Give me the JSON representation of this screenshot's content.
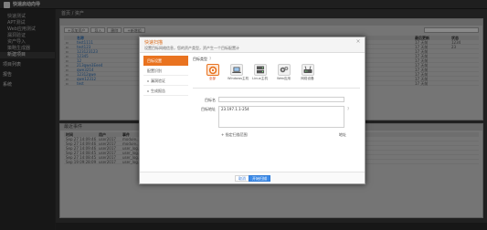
{
  "app": {
    "title": "快速启动向导"
  },
  "breadcrumb": "首页 / 资产",
  "sidebar": {
    "items": [
      {
        "label": "快速测试",
        "active": false
      },
      {
        "label": "APT测试",
        "active": false
      },
      {
        "label": "Web应用测试",
        "active": false
      },
      {
        "label": "漏洞验证",
        "active": false
      },
      {
        "label": "资产导入",
        "active": false
      },
      {
        "label": "策略生成器",
        "active": false
      },
      {
        "label": "新建项目",
        "active": true
      }
    ],
    "groups": [
      {
        "label": "项目列表"
      },
      {
        "label": "报告"
      },
      {
        "label": "系统"
      }
    ]
  },
  "background": {
    "toolbar": [
      "+添加资产",
      "导入",
      "删除",
      "+新增组"
    ],
    "table_headers": [
      "",
      "名称",
      "",
      "最后更新",
      "状态"
    ],
    "table_rows": [
      {
        "name": "test1111",
        "updated": "17 天前",
        "status": "1234"
      },
      {
        "name": "test123",
        "updated": "17 天前",
        "status": "23"
      },
      {
        "name": "123123123",
        "updated": "17 天前",
        "status": ""
      },
      {
        "name": "12345",
        "updated": "17 天前",
        "status": ""
      },
      {
        "name": "12",
        "updated": "17 天前",
        "status": ""
      },
      {
        "name": "213qwe3Eee4",
        "updated": "17 天前",
        "status": ""
      },
      {
        "name": "qwe3214",
        "updated": "17 天前",
        "status": ""
      },
      {
        "name": "12312qwe",
        "updated": "17 天前",
        "status": ""
      },
      {
        "name": "qwe12312",
        "updated": "17 天前",
        "status": ""
      },
      {
        "name": "test",
        "updated": "17 天前",
        "status": ""
      }
    ],
    "logs_title": "最近事件",
    "log_headers": [
      "时间",
      "用户",
      "事件"
    ],
    "log_rows": [
      {
        "time": "Sep 27 14:09:46",
        "user": "user2017",
        "event": "module..."
      },
      {
        "time": "Sep 27 14:09:46",
        "user": "user2017",
        "event": "module..."
      },
      {
        "time": "Sep 27 14:09:46",
        "user": "user2017",
        "event": "user_log..."
      },
      {
        "time": "Sep 27 14:08:45",
        "user": "user2017",
        "event": "user_log..."
      },
      {
        "time": "Sep 27 14:08:45",
        "user": "user2017",
        "event": "user_log..."
      },
      {
        "time": "Sep 19 09:28:09",
        "user": "user2017",
        "event": "user_log..."
      }
    ]
  },
  "modal": {
    "title": "快速扫描",
    "subtitle": "设置目标网络信息，您的资产类型，资产生一个目标配置计",
    "close": "×",
    "steps": [
      {
        "label": "目标设置",
        "active": true
      },
      {
        "label": "配置识别",
        "active": false
      },
      {
        "label": "漏洞验证",
        "active": false
      },
      {
        "label": "生成报告",
        "active": false
      }
    ],
    "type_label": "目标类型",
    "type_help": "?",
    "types": [
      {
        "label": "全部",
        "icon": "target-icon",
        "active": true
      },
      {
        "label": "Windows主机",
        "icon": "laptop-icon",
        "active": false
      },
      {
        "label": "Linux主机",
        "icon": "server-icon",
        "active": false
      },
      {
        "label": "Web应用",
        "icon": "gears-icon",
        "active": false
      },
      {
        "label": "网络设备",
        "icon": "router-icon",
        "active": false
      }
    ],
    "name_label": "目标名",
    "name_value": "",
    "address_label": "目标地址",
    "address_value": "23.197.1.1-254",
    "address_help": "?",
    "scope_label": "+ 指定扫描范围",
    "example_label": "地址",
    "cancel": "取消",
    "start": "开始扫描"
  },
  "colors": {
    "accent": "#e97320",
    "primary_button": "#3d8be8",
    "overlay": "#000000"
  }
}
